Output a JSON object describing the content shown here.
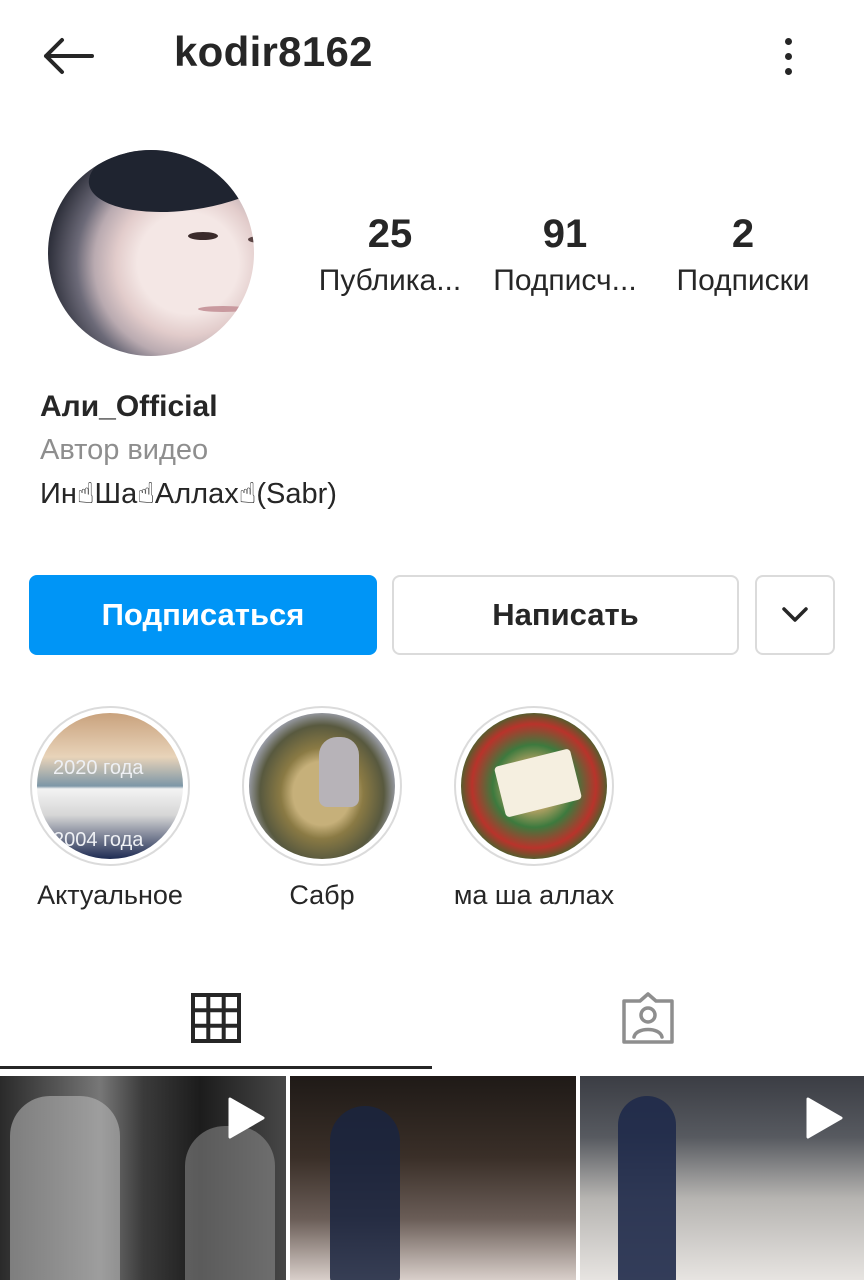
{
  "header": {
    "username": "kodir8162"
  },
  "stats": [
    {
      "value": "25",
      "label": "Публика..."
    },
    {
      "value": "91",
      "label": "Подписч..."
    },
    {
      "value": "2",
      "label": "Подписки"
    }
  ],
  "bio": {
    "name": "Али_Official",
    "category": "Автор видео",
    "text": "Ин☝Ша☝Аллах☝(Sabr)"
  },
  "actions": {
    "follow_label": "Подписаться",
    "message_label": "Написать"
  },
  "highlights": [
    {
      "label": "Актуальное",
      "overlay_top": "2020 года",
      "overlay_bottom": "2004 года"
    },
    {
      "label": "Сабр"
    },
    {
      "label": "ма ша аллах"
    }
  ],
  "colors": {
    "accent": "#0095f6",
    "text": "#262626",
    "secondary_text": "#8e8e8e",
    "border": "#dbdbdb"
  }
}
